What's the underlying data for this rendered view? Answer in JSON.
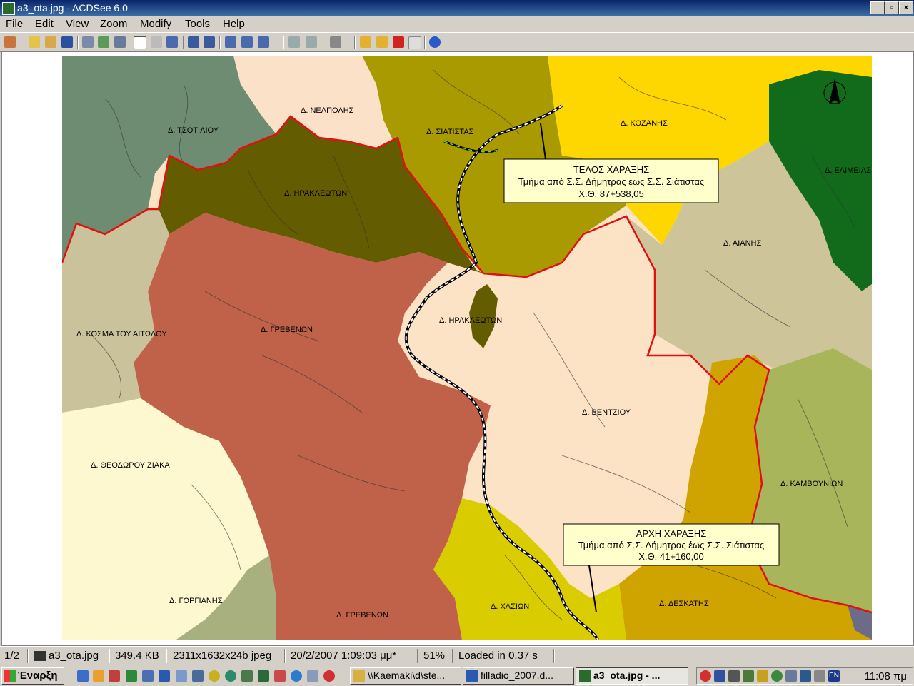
{
  "window": {
    "title": "a3_ota.jpg - ACDSee 6.0",
    "controls": [
      "_",
      "□",
      "×"
    ]
  },
  "menu": [
    "File",
    "Edit",
    "View",
    "Zoom",
    "Modify",
    "Tools",
    "Help"
  ],
  "toolbar": {
    "icons": [
      "acquire-icon",
      "open-icon",
      "browse-icon",
      "save-icon",
      "copy-icon",
      "move-icon",
      "full-screen-icon",
      "hand-tool-icon",
      "select-tool-icon",
      "zoom-tool-icon",
      "fit-image-icon",
      "actual-size-icon",
      "zoom-in-icon",
      "zoom-out-icon",
      "zoom-menu-icon",
      "print-icon",
      "print-menu-icon",
      "effects-icon",
      "open-folder-icon",
      "edit-icon",
      "delete-icon",
      "properties-icon",
      "help-icon"
    ]
  },
  "map": {
    "regions": [
      {
        "label": "Δ. ΤΣΟΤΙΛΙΟΥ",
        "color": "#6e8c72"
      },
      {
        "label": "Δ. ΝΕΑΠΟΛΗΣ",
        "color": "#fbe1c8"
      },
      {
        "label": "Δ. ΣΙΑΤΙΣΤΑΣ",
        "color": "#a89a00"
      },
      {
        "label": "Δ. ΚΟΖΑΝΗΣ",
        "color": "#ffd700"
      },
      {
        "label": "Δ. ΕΛΙΜΕΙΑΣ",
        "color": "#116b1b"
      },
      {
        "label": "Δ. ΗΡΑΚΛΕΩΤΩΝ",
        "color": "#635c00"
      },
      {
        "label": "Δ. ΑΙΑΝΗΣ",
        "color": "#cdc49a"
      },
      {
        "label": "Δ. ΗΡΑΚΛΕΩΤΩΝ",
        "color": "#635c00"
      },
      {
        "label": "Δ. ΓΡΕΒΕΝΩΝ",
        "color": "#c0614a"
      },
      {
        "label": "Δ. ΚΟΣΜΑ ΤΟΥ ΑΙΤΩΛΟΥ",
        "color": "#c9c29a"
      },
      {
        "label": "Δ. ΒΕΝΤΖΙΟΥ",
        "color": "#fde3c6"
      },
      {
        "label": "Δ. ΘΕΟΔΩΡΟΥ ΖΙΑΚΑ",
        "color": "#fdf8cf"
      },
      {
        "label": "Δ. ΚΑΜΒΟΥΝΙΩΝ",
        "color": "#a8b55a"
      },
      {
        "label": "Δ. ΓΟΡΓΙΑΝΗΣ",
        "color": "#a7b07e"
      },
      {
        "label": "Δ. ΧΑΣΙΩΝ",
        "color": "#d9cc00"
      },
      {
        "label": "Δ. ΔΕΣΚΑΤΗΣ",
        "color": "#cfa400"
      },
      {
        "label": "Δ. ΓΡΕΒΕΝΩΝ",
        "color": "#c0614a"
      }
    ],
    "callout_end": {
      "title": "ΤΕΛΟΣ ΧΑΡΑΞΗΣ",
      "subtitle": "Τμήμα από Σ.Σ. Δήμητρας έως Σ.Σ. Σιάτιστας",
      "chainage": "Χ.Θ. 87+538,05"
    },
    "callout_start": {
      "title": "ΑΡΧΗ ΧΑΡΑΞΗΣ",
      "subtitle": "Τμήμα από Σ.Σ. Δήμητρας έως Σ.Σ. Σιάτιστας",
      "chainage": "Χ.Θ. 41+160,00"
    },
    "north_arrow": "north-arrow-icon"
  },
  "status": {
    "index": "1/2",
    "filename": "a3_ota.jpg",
    "filesize": "349.4 KB",
    "dimensions": "2311x1632x24b jpeg",
    "date": "20/2/2007 1:09:03 μμ*",
    "zoom": "51%",
    "load": "Loaded in 0.37 s"
  },
  "taskbar": {
    "start": "Έναρξη",
    "tasks": [
      {
        "label": "\\\\Kaemaki\\d\\ste...",
        "active": false
      },
      {
        "label": "filladio_2007.d...",
        "active": false
      },
      {
        "label": "a3_ota.jpg - ...",
        "active": true
      }
    ],
    "lang": "EN",
    "clock": "11:08 πμ"
  }
}
